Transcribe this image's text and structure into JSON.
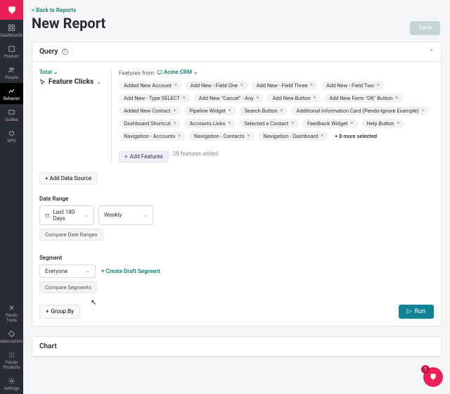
{
  "nav": {
    "items": [
      "Dashboards",
      "Product",
      "People",
      "Behavior",
      "Guides",
      "NPS"
    ],
    "tools": [
      "Pendo Tools",
      "Subscriptions",
      "Pendo Products",
      "Settings"
    ],
    "active": 3
  },
  "header": {
    "back": "< Back to Reports",
    "title": "New Report",
    "save": "Save"
  },
  "query": {
    "title": "Query",
    "total": "Total",
    "metric": "Feature Clicks",
    "features_from": "Features from:",
    "app": "Acme CRM",
    "pills": [
      "Added New Account",
      "Add New - Field One",
      "Add New - Field Three",
      "Add New - Field Two",
      "Add New - Type SELECT",
      "Add New \"Cancel\" - Any",
      "Add New Button",
      "Add New Form \"OK\" Button",
      "Added New Contact",
      "Pipeline Widget",
      "Search Button",
      "Additional Information Card (Pendo-Ignore Example)",
      "Dashboard Shortcut",
      "Accounts Links",
      "Selected a Contact",
      "Feedback Widget",
      "Help Button",
      "Navigation - Accounts",
      "Navigation - Contacts",
      "Navigation - Dashboard"
    ],
    "more_selected": "+ 8 more selected",
    "add_features": "Add Features",
    "features_added": "28 features added",
    "add_data_source": "+ Add Data Source"
  },
  "date_range": {
    "label": "Date Range",
    "value": "Last 180 Days",
    "granularity": "Weekly",
    "compare": "Compare Date Ranges"
  },
  "segment": {
    "label": "Segment",
    "value": "Everyone",
    "create": "+ Create Draft Segment",
    "compare": "Compare Segments"
  },
  "group_by": "Group By",
  "run": "Run",
  "chart": {
    "title": "Chart"
  },
  "fab_badge": "1"
}
